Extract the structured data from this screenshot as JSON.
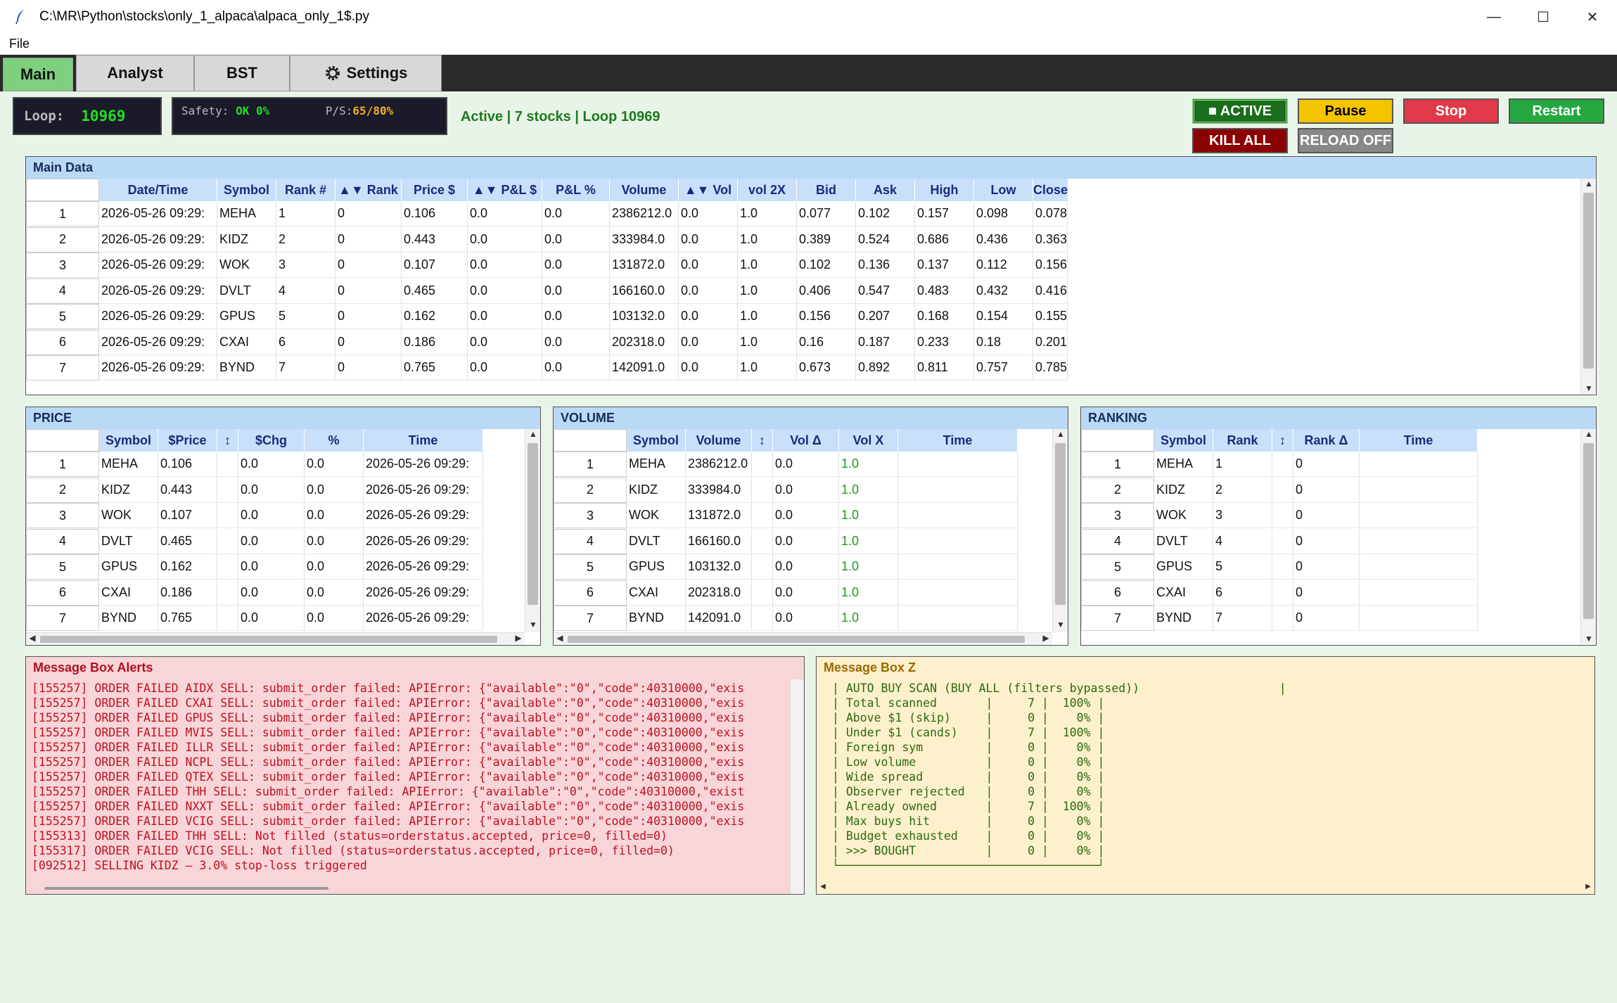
{
  "window": {
    "title": "C:\\MR\\Python\\stocks\\only_1_alpaca\\alpaca_only_1$.py",
    "minimize_glyph": "—",
    "maximize_glyph": "☐",
    "close_glyph": "✕"
  },
  "menu": {
    "file_label": "File"
  },
  "tabs": [
    {
      "label": "Main",
      "active": true
    },
    {
      "label": "Analyst"
    },
    {
      "label": "BST"
    },
    {
      "label": "Settings",
      "icon": "gear-icon"
    }
  ],
  "status": {
    "loop_label": "Loop:",
    "loop_value": "10969",
    "safety_label": "Safety:",
    "safety_value": "OK 0%",
    "ps_label": "P/S:",
    "ps_value": "65/80%",
    "status_text": "Active | 7 stocks | Loop 10969"
  },
  "controls": {
    "active_label": "■ ACTIVE",
    "pause_label": "Pause",
    "stop_label": "Stop",
    "restart_label": "Restart",
    "killall_label": "KILL ALL",
    "reload_label": "RELOAD OFF"
  },
  "main_data": {
    "title": "Main Data",
    "columns": [
      "Date/Time",
      "Symbol",
      "Rank #",
      "▲▼ Rank",
      "Price $",
      "▲▼ P&L $",
      "P&L %",
      "Volume",
      "▲▼ Vol",
      "vol 2X",
      "Bid",
      "Ask",
      "High",
      "Low",
      "Close"
    ],
    "rows": [
      [
        "2026-05-26 09:29:",
        "MEHA",
        "1",
        "0",
        "0.106",
        "0.0",
        "0.0",
        "2386212.0",
        "0.0",
        "1.0",
        "0.077",
        "0.102",
        "0.157",
        "0.098",
        "0.078"
      ],
      [
        "2026-05-26 09:29:",
        "KIDZ",
        "2",
        "0",
        "0.443",
        "0.0",
        "0.0",
        "333984.0",
        "0.0",
        "1.0",
        "0.389",
        "0.524",
        "0.686",
        "0.436",
        "0.363"
      ],
      [
        "2026-05-26 09:29:",
        "WOK",
        "3",
        "0",
        "0.107",
        "0.0",
        "0.0",
        "131872.0",
        "0.0",
        "1.0",
        "0.102",
        "0.136",
        "0.137",
        "0.112",
        "0.156"
      ],
      [
        "2026-05-26 09:29:",
        "DVLT",
        "4",
        "0",
        "0.465",
        "0.0",
        "0.0",
        "166160.0",
        "0.0",
        "1.0",
        "0.406",
        "0.547",
        "0.483",
        "0.432",
        "0.416"
      ],
      [
        "2026-05-26 09:29:",
        "GPUS",
        "5",
        "0",
        "0.162",
        "0.0",
        "0.0",
        "103132.0",
        "0.0",
        "1.0",
        "0.156",
        "0.207",
        "0.168",
        "0.154",
        "0.155"
      ],
      [
        "2026-05-26 09:29:",
        "CXAI",
        "6",
        "0",
        "0.186",
        "0.0",
        "0.0",
        "202318.0",
        "0.0",
        "1.0",
        "0.16",
        "0.187",
        "0.233",
        "0.18",
        "0.201"
      ],
      [
        "2026-05-26 09:29:",
        "BYND",
        "7",
        "0",
        "0.765",
        "0.0",
        "0.0",
        "142091.0",
        "0.0",
        "1.0",
        "0.673",
        "0.892",
        "0.811",
        "0.757",
        "0.785"
      ]
    ]
  },
  "price_panel": {
    "title": "PRICE",
    "columns": [
      "Symbol",
      "$Price",
      "↕",
      "$Chg",
      "%",
      "Time"
    ],
    "rows": [
      [
        "MEHA",
        "0.106",
        "",
        "0.0",
        "0.0",
        "2026-05-26 09:29:"
      ],
      [
        "KIDZ",
        "0.443",
        "",
        "0.0",
        "0.0",
        "2026-05-26 09:29:"
      ],
      [
        "WOK",
        "0.107",
        "",
        "0.0",
        "0.0",
        "2026-05-26 09:29:"
      ],
      [
        "DVLT",
        "0.465",
        "",
        "0.0",
        "0.0",
        "2026-05-26 09:29:"
      ],
      [
        "GPUS",
        "0.162",
        "",
        "0.0",
        "0.0",
        "2026-05-26 09:29:"
      ],
      [
        "CXAI",
        "0.186",
        "",
        "0.0",
        "0.0",
        "2026-05-26 09:29:"
      ],
      [
        "BYND",
        "0.765",
        "",
        "0.0",
        "0.0",
        "2026-05-26 09:29:"
      ]
    ]
  },
  "volume_panel": {
    "title": "VOLUME",
    "columns": [
      "Symbol",
      "Volume",
      "↕",
      "Vol Δ",
      "Vol X",
      "Time"
    ],
    "rows": [
      [
        "MEHA",
        "2386212.0",
        "",
        "0.0",
        "1.0",
        ""
      ],
      [
        "KIDZ",
        "333984.0",
        "",
        "0.0",
        "1.0",
        ""
      ],
      [
        "WOK",
        "131872.0",
        "",
        "0.0",
        "1.0",
        ""
      ],
      [
        "DVLT",
        "166160.0",
        "",
        "0.0",
        "1.0",
        ""
      ],
      [
        "GPUS",
        "103132.0",
        "",
        "0.0",
        "1.0",
        ""
      ],
      [
        "CXAI",
        "202318.0",
        "",
        "0.0",
        "1.0",
        ""
      ],
      [
        "BYND",
        "142091.0",
        "",
        "0.0",
        "1.0",
        ""
      ]
    ]
  },
  "ranking_panel": {
    "title": "RANKING",
    "columns": [
      "Symbol",
      "Rank",
      "↕",
      "Rank Δ",
      "Time"
    ],
    "rows": [
      [
        "MEHA",
        "1",
        "",
        "0",
        ""
      ],
      [
        "KIDZ",
        "2",
        "",
        "0",
        ""
      ],
      [
        "WOK",
        "3",
        "",
        "0",
        ""
      ],
      [
        "DVLT",
        "4",
        "",
        "0",
        ""
      ],
      [
        "GPUS",
        "5",
        "",
        "0",
        ""
      ],
      [
        "CXAI",
        "6",
        "",
        "0",
        ""
      ],
      [
        "BYND",
        "7",
        "",
        "0",
        ""
      ]
    ]
  },
  "alerts": {
    "title": "Message Box Alerts",
    "lines": [
      "[155257] ORDER FAILED AIDX SELL: submit_order failed: APIError: {\"available\":\"0\",\"code\":40310000,\"exis",
      "[155257] ORDER FAILED CXAI SELL: submit_order failed: APIError: {\"available\":\"0\",\"code\":40310000,\"exis",
      "[155257] ORDER FAILED GPUS SELL: submit_order failed: APIError: {\"available\":\"0\",\"code\":40310000,\"exis",
      "[155257] ORDER FAILED MVIS SELL: submit_order failed: APIError: {\"available\":\"0\",\"code\":40310000,\"exis",
      "[155257] ORDER FAILED ILLR SELL: submit_order failed: APIError: {\"available\":\"0\",\"code\":40310000,\"exis",
      "[155257] ORDER FAILED NCPL SELL: submit_order failed: APIError: {\"available\":\"0\",\"code\":40310000,\"exis",
      "[155257] ORDER FAILED QTEX SELL: submit_order failed: APIError: {\"available\":\"0\",\"code\":40310000,\"exis",
      "[155257] ORDER FAILED THH SELL: submit_order failed: APIError: {\"available\":\"0\",\"code\":40310000,\"exist",
      "[155257] ORDER FAILED NXXT SELL: submit_order failed: APIError: {\"available\":\"0\",\"code\":40310000,\"exis",
      "[155257] ORDER FAILED VCIG SELL: submit_order failed: APIError: {\"available\":\"0\",\"code\":40310000,\"exis",
      "[155313] ORDER FAILED THH SELL: Not filled (status=orderstatus.accepted, price=0, filled=0)",
      "[155317] ORDER FAILED VCIG SELL: Not filled (status=orderstatus.accepted, price=0, filled=0)",
      "[092512] SELLING KIDZ — 3.0% stop-loss triggered"
    ]
  },
  "boxz": {
    "title": "Message Box Z",
    "lines": [
      "| AUTO BUY SCAN (BUY ALL (filters bypassed))                    |",
      "| Total scanned       |     7 |  100% |",
      "| Above $1 (skip)     |     0 |    0% |",
      "| Under $1 (cands)    |     7 |  100% |",
      "| Foreign sym         |     0 |    0% |",
      "| Low volume          |     0 |    0% |",
      "| Wide spread         |     0 |    0% |",
      "| Observer rejected   |     0 |    0% |",
      "| Already owned       |     7 |  100% |",
      "| Max buys hit        |     0 |    0% |",
      "| Budget exhausted    |     0 |    0% |",
      "| >>> BOUGHT          |     0 |    0% |",
      "└─────────────────────────────────────┘"
    ]
  }
}
